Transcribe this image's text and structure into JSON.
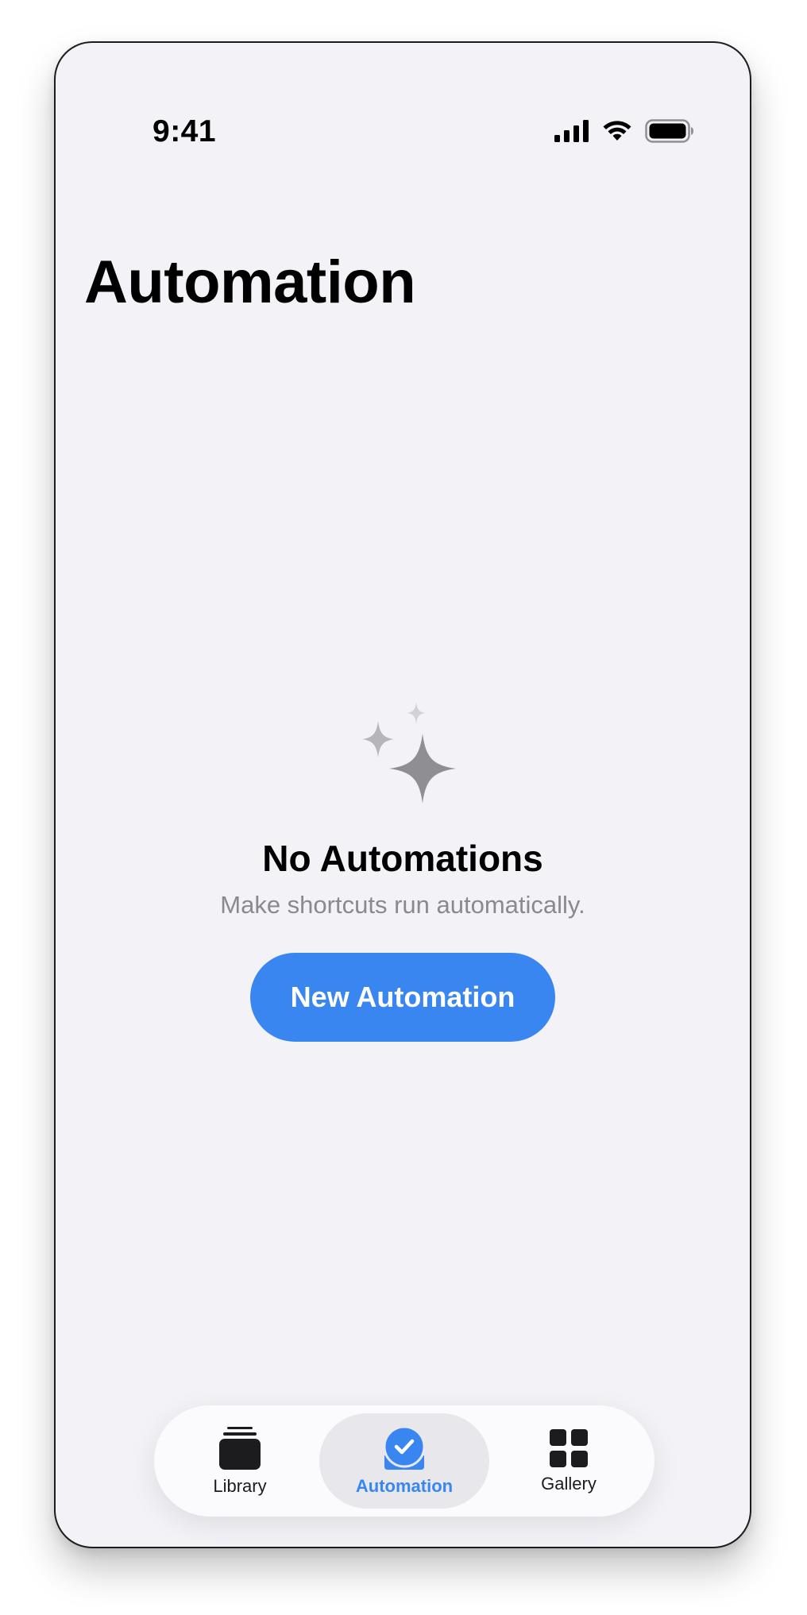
{
  "status_bar": {
    "time": "9:41",
    "icons": [
      "cellular-signal-icon",
      "wifi-icon",
      "battery-icon"
    ]
  },
  "page": {
    "title": "Automation"
  },
  "empty_state": {
    "icon": "sparkles-icon",
    "title": "No Automations",
    "subtitle": "Make shortcuts run automatically.",
    "button_label": "New Automation"
  },
  "tab_bar": {
    "tabs": [
      {
        "label": "Library",
        "icon": "stack-icon",
        "selected": false
      },
      {
        "label": "Automation",
        "icon": "clock-check-icon",
        "selected": true
      },
      {
        "label": "Gallery",
        "icon": "grid-icon",
        "selected": false
      }
    ]
  },
  "colors": {
    "accent": "#3a86f0",
    "background": "#f2f2f7",
    "secondary_text": "#8a8a8e"
  }
}
